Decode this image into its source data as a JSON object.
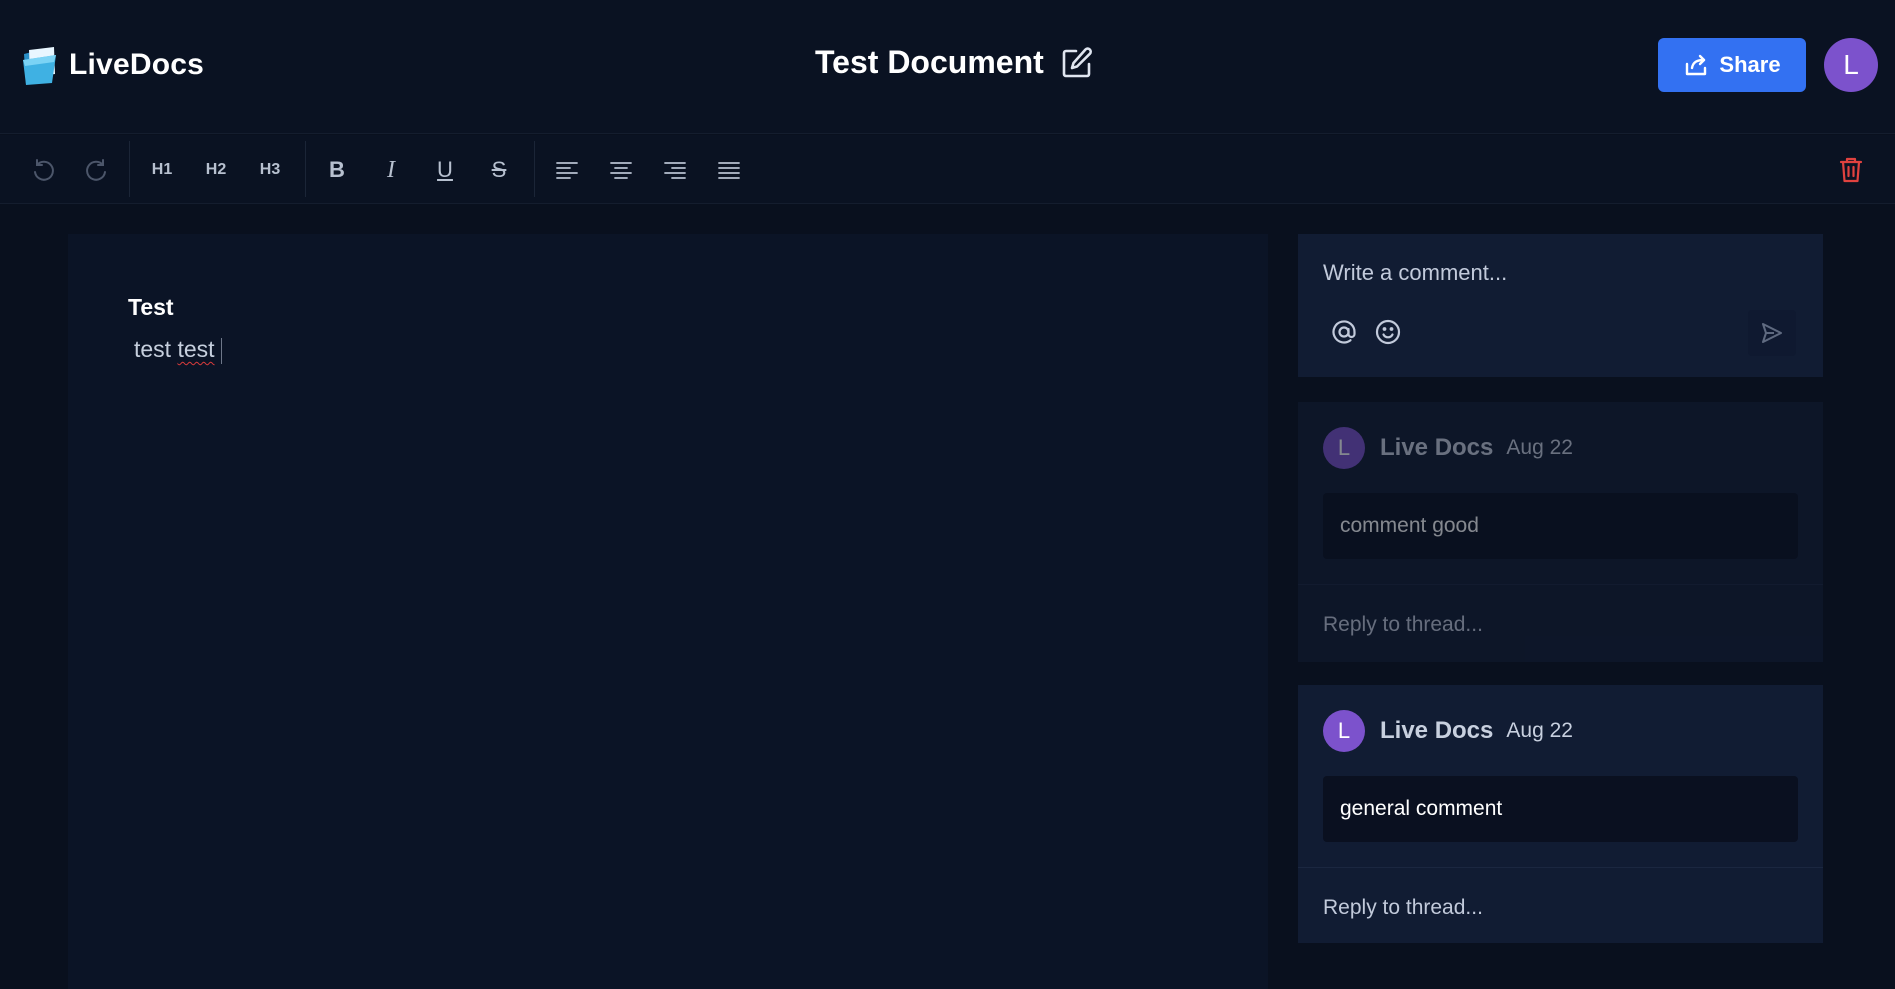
{
  "app": {
    "name": "LiveDocs"
  },
  "document": {
    "title": "Test Document",
    "heading": "Test",
    "paragraph_word1": "test",
    "paragraph_word2": "test"
  },
  "header": {
    "share_label": "Share",
    "user_initial": "L"
  },
  "toolbar": {
    "undo": "undo-icon",
    "redo": "redo-icon",
    "h1": "H1",
    "h2": "H2",
    "h3": "H3",
    "bold": "B",
    "italic": "I",
    "underline": "U",
    "strike": "S",
    "align": [
      "align-left-icon",
      "align-center-icon",
      "align-right-icon",
      "align-justify-icon"
    ],
    "delete": "trash-icon"
  },
  "comments": {
    "composer_placeholder": "Write a comment...",
    "threads": [
      {
        "author": "Live Docs",
        "initial": "L",
        "date": "Aug 22",
        "body": "comment good",
        "reply_placeholder": "Reply to thread...",
        "resolved": true
      },
      {
        "author": "Live Docs",
        "initial": "L",
        "date": "Aug 22",
        "body": "general comment",
        "reply_placeholder": "Reply to thread...",
        "resolved": false
      }
    ]
  },
  "colors": {
    "accent": "#3371f2",
    "avatar": "#7c52cc",
    "danger": "#e0423f",
    "background": "#09101e"
  }
}
